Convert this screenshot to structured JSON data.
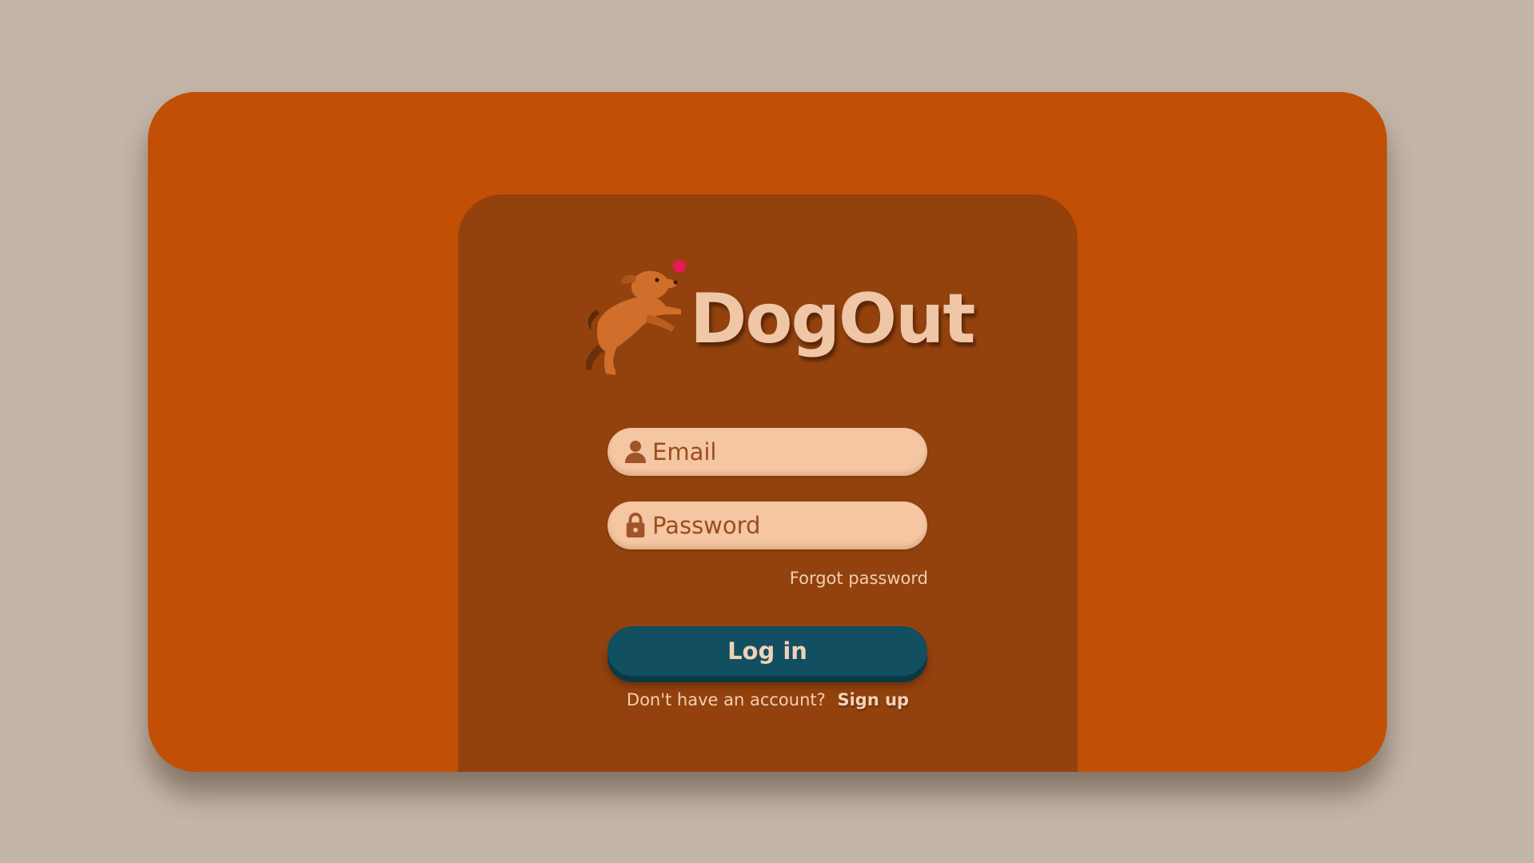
{
  "brand": {
    "name": "DogOut",
    "logo_icon": "dog-jumping-ball-icon"
  },
  "login_form": {
    "email": {
      "placeholder": "Email",
      "value": "",
      "icon": "user-icon"
    },
    "password": {
      "placeholder": "Password",
      "value": "",
      "icon": "lock-icon"
    },
    "forgot_password_label": "Forgot password",
    "login_button_label": "Log in",
    "signup_prompt": "Don't have an account?",
    "signup_link_label": "Sign up"
  },
  "colors": {
    "page_background": "#c4b5a9",
    "frame_background": "#c24f06",
    "panel_background": "#93420e",
    "input_background": "#f4c6a1",
    "button_background": "#124f60",
    "brand_text": "#efc6a6",
    "ball_accent": "#e8195a"
  }
}
